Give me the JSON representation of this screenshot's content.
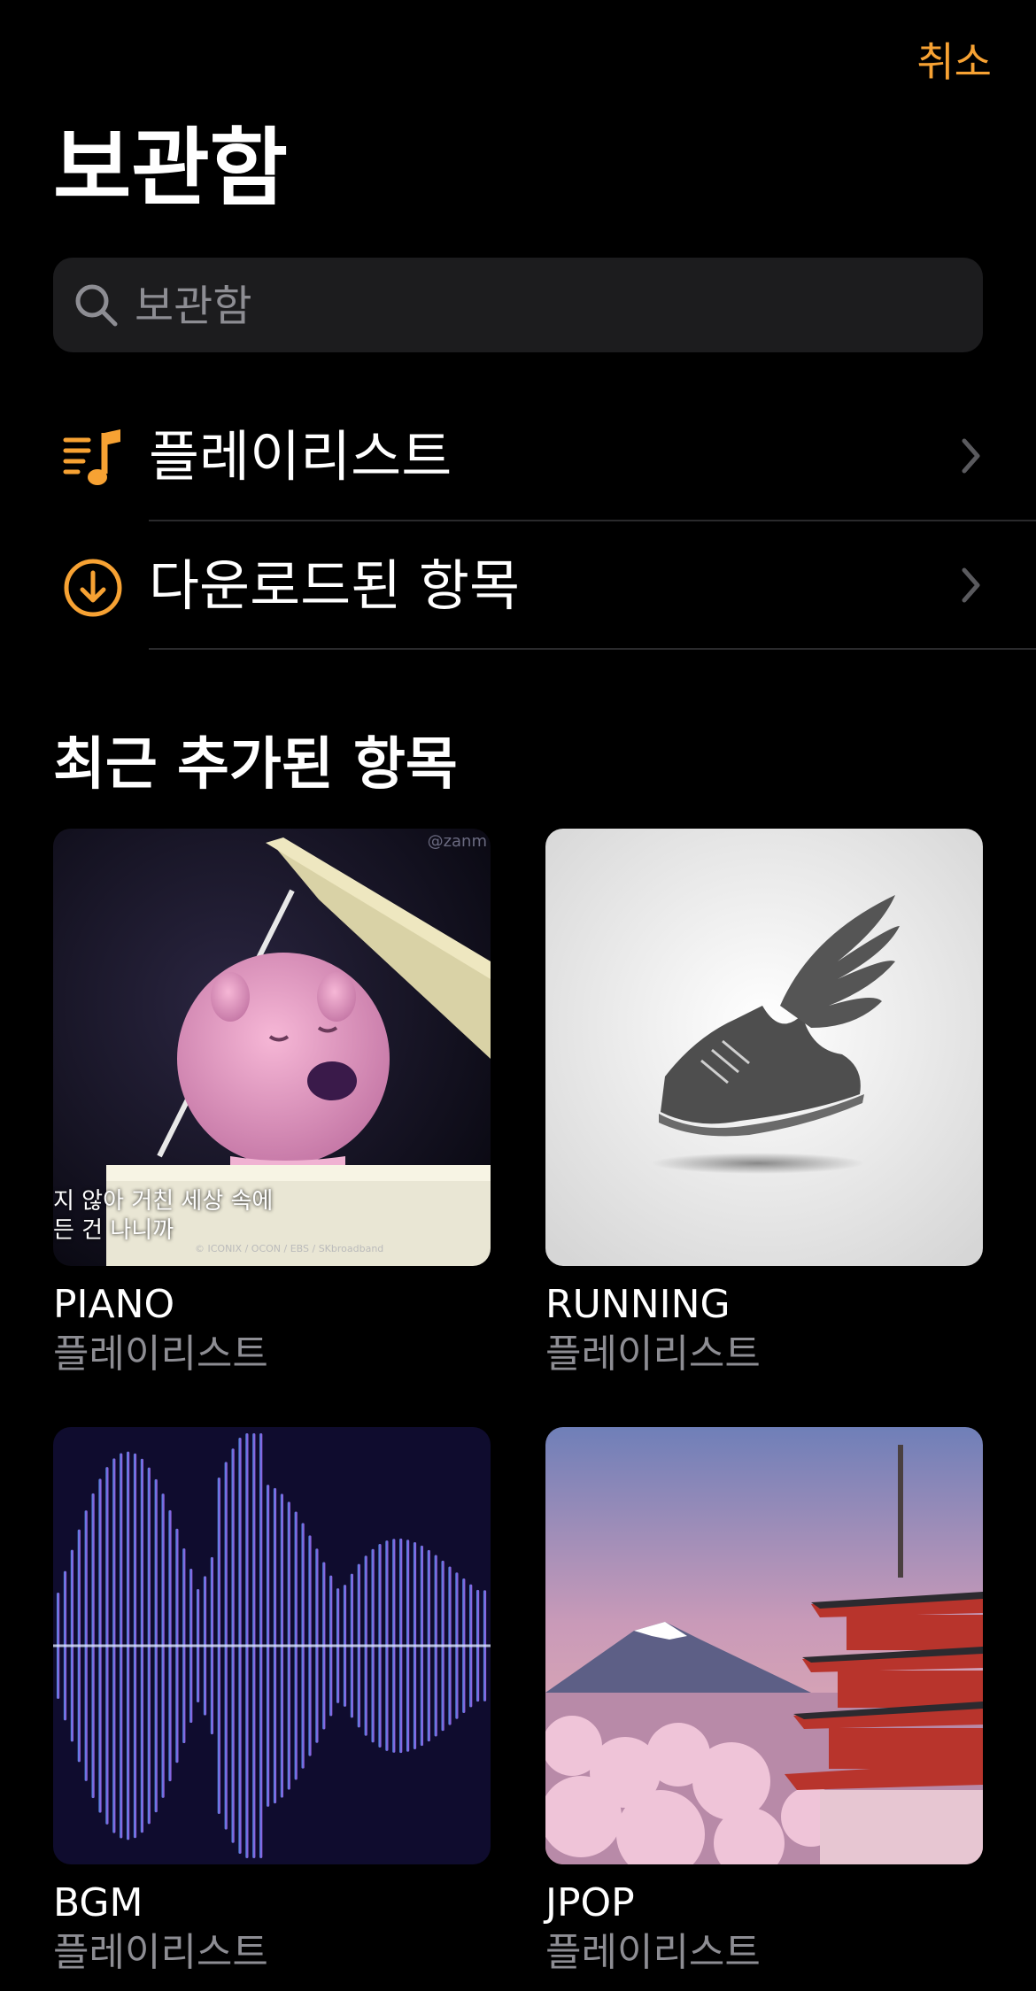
{
  "header": {
    "cancel_label": "취소",
    "title": "보관함"
  },
  "search": {
    "placeholder": "보관함"
  },
  "menu": [
    {
      "label": "플레이리스트",
      "icon": "playlist-icon"
    },
    {
      "label": "다운로드된 항목",
      "icon": "download-circle-icon"
    }
  ],
  "recent": {
    "title": "최근 추가된 항목",
    "items": [
      {
        "name": "PIANO",
        "kind": "플레이리스트",
        "overlay_line1": "지 않아 거친 세상 속에",
        "overlay_line2": "든 건 나니까",
        "credit": "© ICONIX / OCON / EBS / SKbroadband",
        "watermark": "@zanm"
      },
      {
        "name": "RUNNING",
        "kind": "플레이리스트"
      },
      {
        "name": "BGM",
        "kind": "플레이리스트"
      },
      {
        "name": "JPOP",
        "kind": "플레이리스트"
      }
    ]
  },
  "colors": {
    "accent": "#f7a233",
    "background": "#000000",
    "secondary_text": "#8d8d93",
    "search_bg": "#1c1c1e"
  }
}
